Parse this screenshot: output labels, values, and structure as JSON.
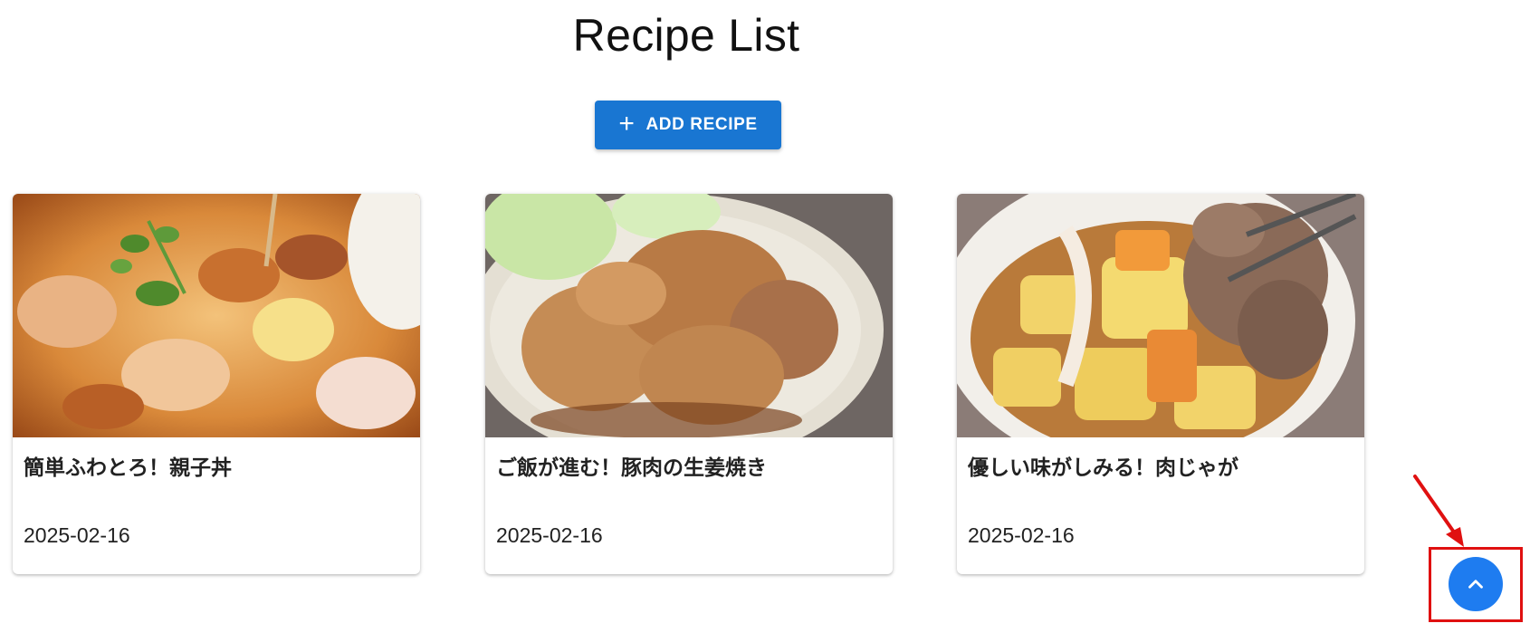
{
  "page": {
    "title": "Recipe List"
  },
  "toolbar": {
    "add_label": "ADD RECIPE",
    "add_icon": "plus-icon"
  },
  "recipes": [
    {
      "title": "簡単ふわとろ！親子丼",
      "date": "2025-02-16",
      "image": "oyakodon-photo"
    },
    {
      "title": "ご飯が進む！豚肉の生姜焼き",
      "date": "2025-02-16",
      "image": "shogayaki-photo"
    },
    {
      "title": "優しい味がしみる！肉じゃが",
      "date": "2025-02-16",
      "image": "nikujaga-photo"
    }
  ],
  "scroll_top": {
    "icon": "chevron-up-icon"
  },
  "colors": {
    "primary": "#1976d2",
    "fab": "#1e7cf0",
    "annotation": "#e01010"
  }
}
